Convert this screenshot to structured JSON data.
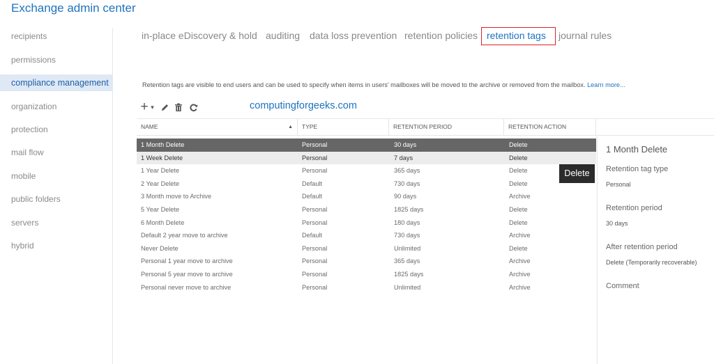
{
  "app": {
    "title": "Exchange admin center"
  },
  "sidebar": {
    "items": [
      {
        "label": "recipients",
        "active": false
      },
      {
        "label": "permissions",
        "active": false
      },
      {
        "label": "compliance management",
        "active": true
      },
      {
        "label": "organization",
        "active": false
      },
      {
        "label": "protection",
        "active": false
      },
      {
        "label": "mail flow",
        "active": false
      },
      {
        "label": "mobile",
        "active": false
      },
      {
        "label": "public folders",
        "active": false
      },
      {
        "label": "servers",
        "active": false
      },
      {
        "label": "hybrid",
        "active": false
      }
    ]
  },
  "tabs": [
    {
      "label": "in-place eDiscovery & hold",
      "selected": false
    },
    {
      "label": "auditing",
      "selected": false
    },
    {
      "label": "data loss prevention",
      "selected": false
    },
    {
      "label": "retention policies",
      "selected": false
    },
    {
      "label": "retention tags",
      "selected": true
    },
    {
      "label": "journal rules",
      "selected": false
    }
  ],
  "description": {
    "text": "Retention tags are visible to end users and can be used to specify when items in users' mailboxes will be moved to the archive or removed from the mailbox.",
    "link": "Learn more..."
  },
  "toolbar": {
    "icons": [
      "add-icon",
      "dropdown-arrow-icon",
      "edit-pencil-icon",
      "delete-trash-icon",
      "refresh-icon"
    ],
    "add_symbol": "+",
    "dropdown_symbol": "▾"
  },
  "watermark": "computingforgeeks.com",
  "grid": {
    "columns": [
      "NAME",
      "TYPE",
      "RETENTION PERIOD",
      "RETENTION ACTION"
    ],
    "sort_indicator": "▲",
    "rows": [
      [
        "1 Month Delete",
        "Personal",
        "30 days",
        "Delete"
      ],
      [
        "1 Week Delete",
        "Personal",
        "7 days",
        "Delete"
      ],
      [
        "1 Year Delete",
        "Personal",
        "365 days",
        "Delete"
      ],
      [
        "2 Year Delete",
        "Default",
        "730 days",
        "Delete"
      ],
      [
        "3 Month move to Archive",
        "Default",
        "90 days",
        "Archive"
      ],
      [
        "5 Year Delete",
        "Personal",
        "1825 days",
        "Delete"
      ],
      [
        "6 Month Delete",
        "Personal",
        "180 days",
        "Delete"
      ],
      [
        "Default 2 year move to archive",
        "Default",
        "730 days",
        "Archive"
      ],
      [
        "Never Delete",
        "Personal",
        "Unlimited",
        "Delete"
      ],
      [
        "Personal 1 year move to archive",
        "Personal",
        "365 days",
        "Archive"
      ],
      [
        "Personal 5 year move to archive",
        "Personal",
        "1825 days",
        "Archive"
      ],
      [
        "Personal never move to archive",
        "Personal",
        "Unlimited",
        "Archive"
      ]
    ],
    "selected_row": 0,
    "hovered_row": 1
  },
  "tooltip": {
    "text": "Delete"
  },
  "details": {
    "title": "1 Month Delete",
    "tag_type_label": "Retention tag type",
    "tag_type_value": "Personal",
    "period_label": "Retention period",
    "period_value": "30 days",
    "after_label": "After retention period",
    "after_value": "Delete (Temporarily recoverable)",
    "comment_label": "Comment"
  },
  "colors": {
    "accent": "#1e73be",
    "selected_row": "#666666",
    "hover_row": "#ececec",
    "highlight_border": "#d9232a",
    "active_nav": "#dfe9f5"
  }
}
